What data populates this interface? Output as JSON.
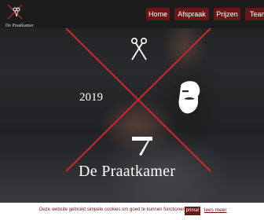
{
  "brand": {
    "logo_text": "De Praatkamer",
    "year": "2019",
    "name": "De Praatkamer"
  },
  "nav": {
    "items": [
      {
        "label": "Home"
      },
      {
        "label": "Afspraak"
      },
      {
        "label": "Prijzen"
      },
      {
        "label": "Team"
      }
    ]
  },
  "icons": {
    "scissors": "scissors-icon",
    "barber_face": "bearded-man-icon",
    "razor": "straight-razor-icon",
    "cross": "red-cross-lines"
  },
  "cookie": {
    "message": "Deze website gebruikt simpele cookies om goed te kunnen functioneren!",
    "accept_label": "prima!",
    "more_label": "lees meer"
  },
  "colors": {
    "accent": "#6b1616",
    "cross_red": "#c62828",
    "nav_bg": "#1c1c1c"
  }
}
